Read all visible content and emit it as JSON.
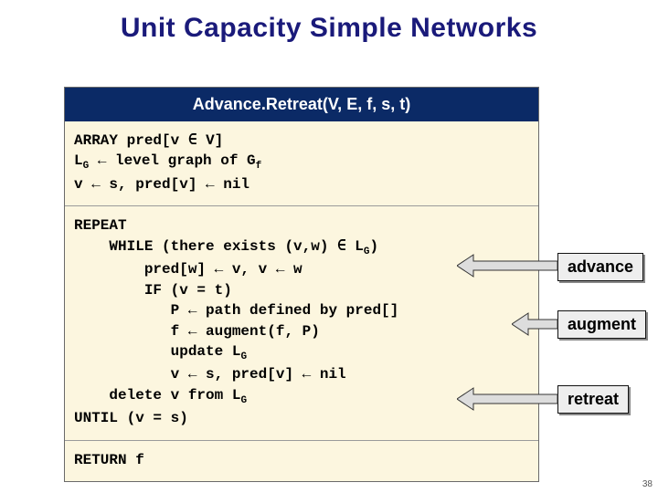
{
  "title": "Unit Capacity Simple Networks",
  "header": "Advance.Retreat(V, E, f, s, t)",
  "code": {
    "block1_l1a": "ARRAY pred[v ",
    "block1_l1b": " V]",
    "block1_l2a": "L",
    "block1_l2_sub": "G",
    "block1_l2b": " ← level graph of G",
    "block1_l2_sub2": "f",
    "block1_l3": "v ← s, pred[v] ← nil",
    "block2_l1": "REPEAT",
    "block2_l2a": "    WHILE (there exists (v,w) ",
    "block2_l2b": " L",
    "block2_l2_sub": "G",
    "block2_l2c": ")",
    "block2_l3": "        pred[w] ← v, v ← w",
    "block2_l4": "        IF (v = t)",
    "block2_l5": "           P ← path defined by pred[]",
    "block2_l6": "           f ← augment(f, P)",
    "block2_l7a": "           update L",
    "block2_l7_sub": "G",
    "block2_l8": "           v ← s, pred[v] ← nil",
    "block2_l9a": "    delete v from L",
    "block2_l9_sub": "G",
    "block2_l10": "UNTIL (v = s)",
    "block3_l1": "RETURN f"
  },
  "labels": {
    "advance": "advance",
    "augment": "augment",
    "retreat": "retreat"
  },
  "glyphs": {
    "element": "∈"
  },
  "pagenum": "38"
}
